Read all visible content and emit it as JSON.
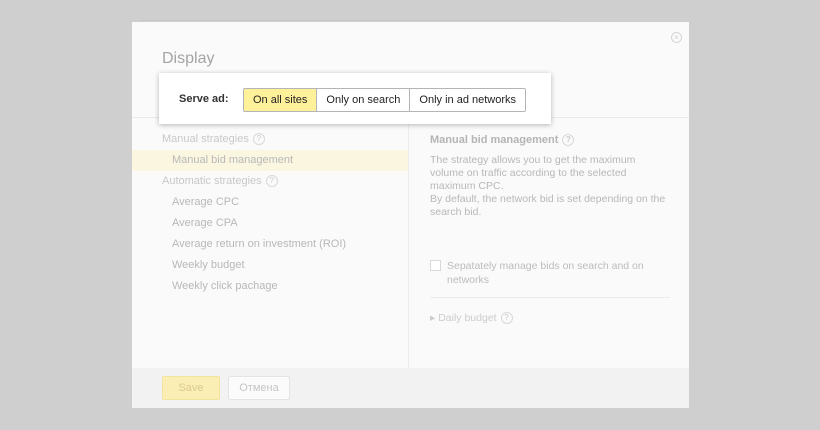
{
  "dialog": {
    "title": "Display",
    "close_icon": "close-icon"
  },
  "serve_popup": {
    "label": "Serve ad:",
    "options": [
      "On all sites",
      "Only on search",
      "Only in ad networks"
    ],
    "selected": "On all sites"
  },
  "strategies": {
    "manual_group": "Manual strategies",
    "manual_items": [
      "Manual bid management"
    ],
    "automatic_group": "Automatic strategies",
    "automatic_items": [
      "Average CPC",
      "Average CPA",
      "Average return on investment (ROI)",
      "Weekly budget",
      "Weekly click pachage"
    ],
    "help_glyph": "?"
  },
  "details": {
    "title": "Manual bid management",
    "description_1": "The strategy allows you to get the maximum volume on traffic according to the selected maximum CPC.",
    "description_2": "By default, the network bid is set depending on the search bid.",
    "checkbox_label": "Sepatately manage bids on search and on networks",
    "checkbox_checked": false,
    "daily_budget": "Daily budget"
  },
  "footer": {
    "save_label": "Save",
    "cancel_label": "Отмена"
  },
  "colors": {
    "accent": "#fff09a",
    "overlay": "#cfcfcf"
  }
}
